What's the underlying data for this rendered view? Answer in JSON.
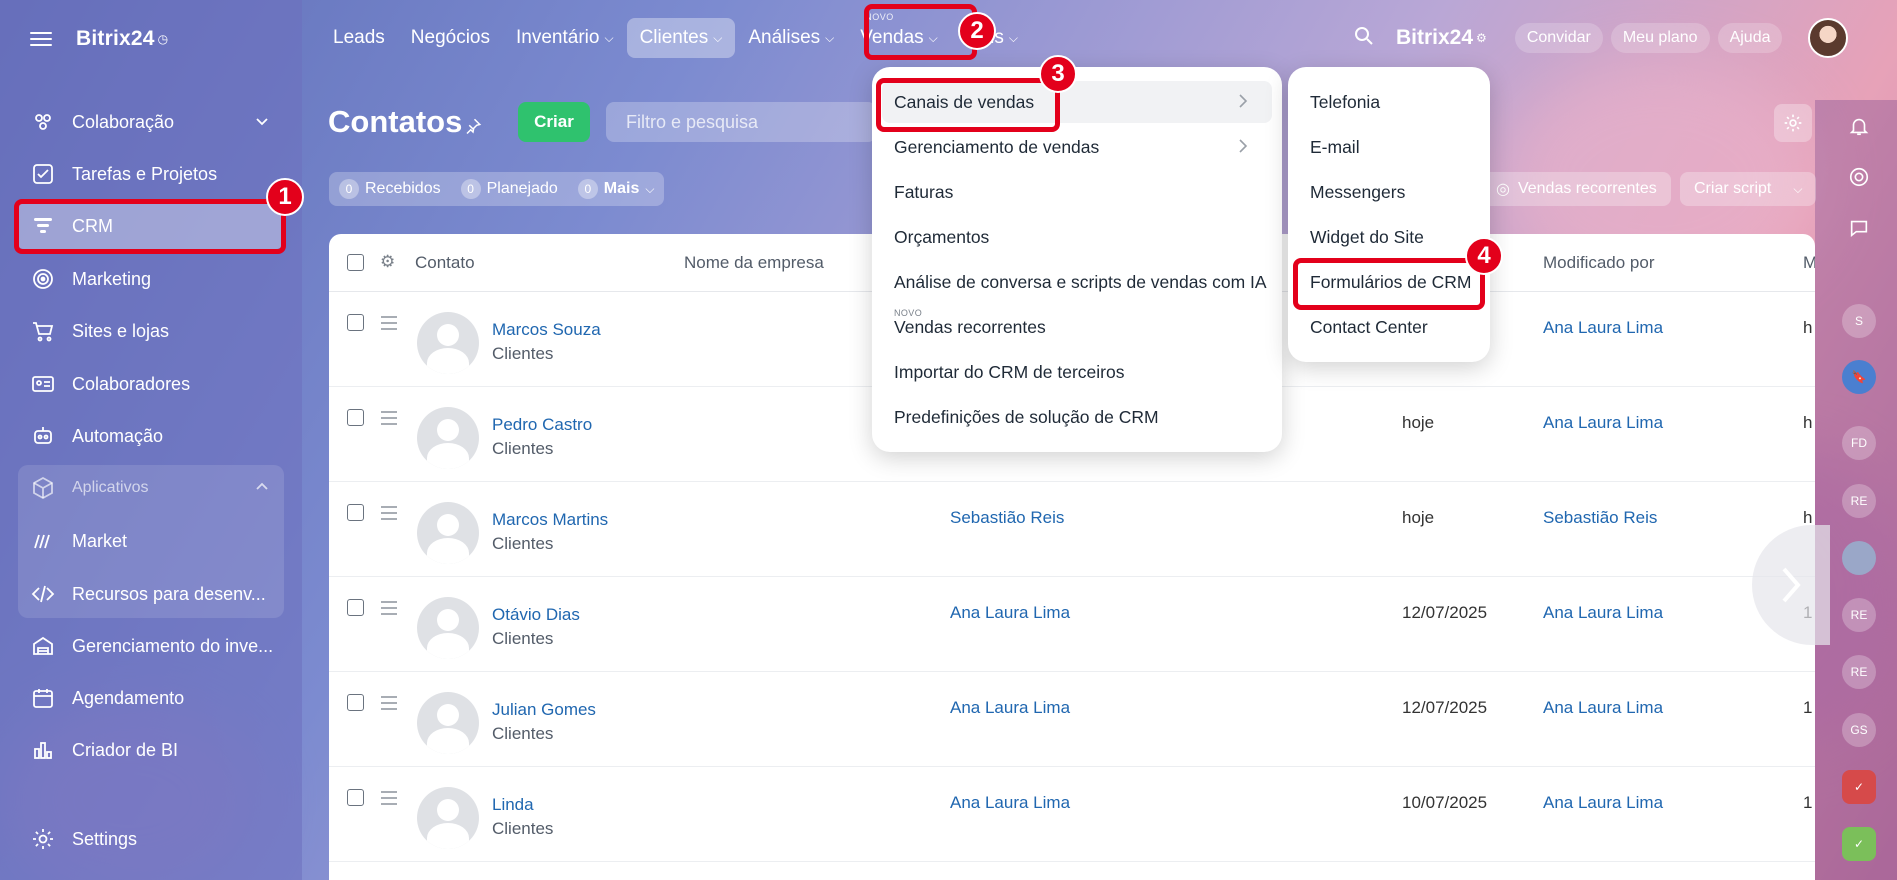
{
  "sidebar": {
    "brand": "Bitrix24",
    "items": [
      {
        "label": "Colaboração"
      },
      {
        "label": "Tarefas e Projetos"
      },
      {
        "label": "CRM"
      },
      {
        "label": "Marketing"
      },
      {
        "label": "Sites e lojas"
      },
      {
        "label": "Colaboradores"
      },
      {
        "label": "Automação"
      },
      {
        "label": "Aplicativos"
      },
      {
        "label": "Market"
      },
      {
        "label": "Recursos para desenv..."
      },
      {
        "label": "Gerenciamento do inve..."
      },
      {
        "label": "Agendamento"
      },
      {
        "label": "Criador de BI"
      },
      {
        "label": "Settings"
      }
    ]
  },
  "topnav": {
    "items": [
      {
        "label": "Leads"
      },
      {
        "label": "Negócios"
      },
      {
        "label": "Inventário"
      },
      {
        "label": "Clientes"
      },
      {
        "label": "Análises"
      },
      {
        "label": "Vendas",
        "tag": "NOVO"
      },
      {
        "label": "Mais"
      }
    ],
    "brand": "Bitrix24",
    "invite": "Convidar",
    "plan": "Meu plano",
    "help": "Ajuda"
  },
  "page": {
    "title": "Contatos",
    "create": "Criar",
    "filter_placeholder": "Filtro e pesquisa",
    "counters": [
      {
        "n": "0",
        "label": "Recebidos"
      },
      {
        "n": "0",
        "label": "Planejado"
      },
      {
        "n": "0",
        "label": "Mais"
      }
    ],
    "recurring": "Vendas recorrentes",
    "script": "Criar script"
  },
  "table": {
    "columns": [
      "Contato",
      "Nome da empresa",
      "Modificado por",
      "M"
    ],
    "rows": [
      {
        "name": "Marcos Souza",
        "type": "Clientes",
        "resp": "",
        "date": "",
        "modby": "Ana Laura Lima",
        "more": "h"
      },
      {
        "name": "Pedro Castro",
        "type": "Clientes",
        "resp": "",
        "date": "hoje",
        "modby": "Ana Laura Lima",
        "more": "h"
      },
      {
        "name": "Marcos Martins",
        "type": "Clientes",
        "resp": "Sebastião Reis",
        "date": "hoje",
        "modby": "Sebastião Reis",
        "more": "h"
      },
      {
        "name": "Otávio Dias",
        "type": "Clientes",
        "resp": "Ana Laura Lima",
        "date": "12/07/2025",
        "modby": "Ana Laura Lima",
        "more": "1"
      },
      {
        "name": "Julian Gomes",
        "type": "Clientes",
        "resp": "Ana Laura Lima",
        "date": "12/07/2025",
        "modby": "Ana Laura Lima",
        "more": "1"
      },
      {
        "name": "Linda",
        "type": "Clientes",
        "resp": "Ana Laura Lima",
        "date": "10/07/2025",
        "modby": "Ana Laura Lima",
        "more": "1"
      }
    ]
  },
  "menu_vendas": {
    "items": [
      {
        "label": "Canais de vendas"
      },
      {
        "label": "Gerenciamento de vendas"
      },
      {
        "label": "Faturas"
      },
      {
        "label": "Orçamentos"
      },
      {
        "label": "Análise de conversa e scripts de vendas com IA"
      },
      {
        "label": "Vendas recorrentes",
        "tag": "NOVO"
      },
      {
        "label": "Importar do CRM de terceiros"
      },
      {
        "label": "Predefinições de solução de CRM"
      }
    ]
  },
  "menu_canais": {
    "items": [
      {
        "label": "Telefonia"
      },
      {
        "label": "E-mail"
      },
      {
        "label": "Messengers"
      },
      {
        "label": "Widget do Site"
      },
      {
        "label": "Formulários de CRM"
      },
      {
        "label": "Contact Center"
      }
    ]
  },
  "rail": {
    "avatars": [
      "S",
      "FD",
      "RE",
      "RE",
      "RE",
      "GS"
    ]
  },
  "annotations": [
    "1",
    "2",
    "3",
    "4"
  ],
  "colors": {
    "accent_red": "#e3001b",
    "create_green": "#2fc26e",
    "link_blue": "#2067b0"
  }
}
